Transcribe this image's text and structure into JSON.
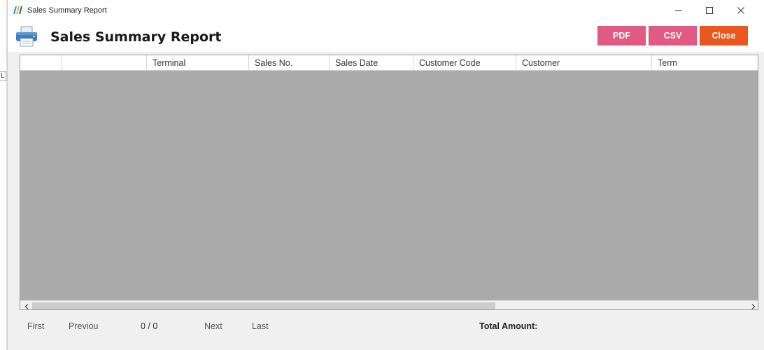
{
  "window": {
    "title": "Sales Summary Report",
    "minimize_icon": "minimize-icon",
    "maximize_icon": "maximize-icon",
    "close_icon": "close-icon"
  },
  "left_edge": {
    "tag": "L"
  },
  "header": {
    "icon": "printer-icon",
    "title": "Sales Summary Report"
  },
  "toolbar": {
    "pdf_label": "PDF",
    "csv_label": "CSV",
    "close_label": "Close",
    "colors": {
      "pdf": "#e05a83",
      "csv": "#e05a83",
      "close": "#e8571e"
    }
  },
  "grid": {
    "columns": [
      "",
      "",
      "Terminal",
      "Sales No.",
      "Sales Date",
      "Customer Code",
      "Customer",
      "Term"
    ],
    "rows": [],
    "background": "#ababab"
  },
  "footer": {
    "first_label": "First",
    "prev_label": "Previou",
    "page_count": "0 / 0",
    "next_label": "Next",
    "last_label": "Last",
    "total_label": "Total Amount:"
  }
}
